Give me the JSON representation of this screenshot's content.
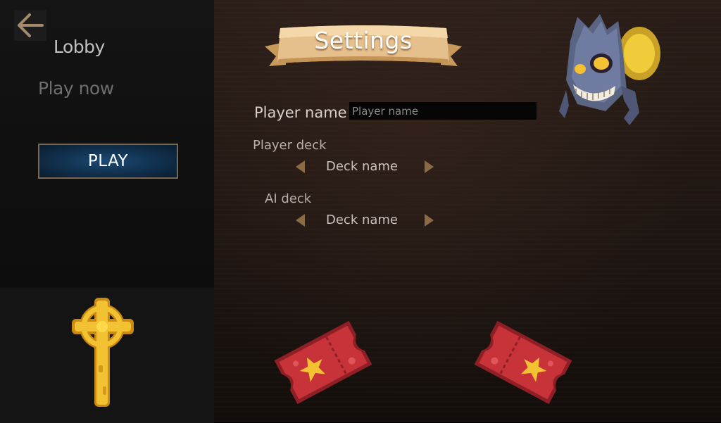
{
  "sidebar": {
    "title": "Lobby",
    "subtitle": "Play now",
    "play_label": "PLAY"
  },
  "header": {
    "title": "Settings"
  },
  "settings": {
    "player_name_label": "Player name",
    "player_name_placeholder": "Player name",
    "player_name_value": "",
    "player_deck_label": "Player deck",
    "player_deck_value": "Deck name",
    "ai_deck_label": "AI deck",
    "ai_deck_value": "Deck name"
  },
  "icons": {
    "back": "arrow-left-icon",
    "cross": "celtic-cross-icon",
    "monster": "monster-portrait-icon",
    "ticket": "ticket-star-icon"
  },
  "colors": {
    "accent_arrow": "#8b6b44",
    "play_button_blue": "#123453",
    "banner_parchment": "#e6c08c",
    "ticket_red": "#c8333a",
    "gold": "#f2c233"
  }
}
